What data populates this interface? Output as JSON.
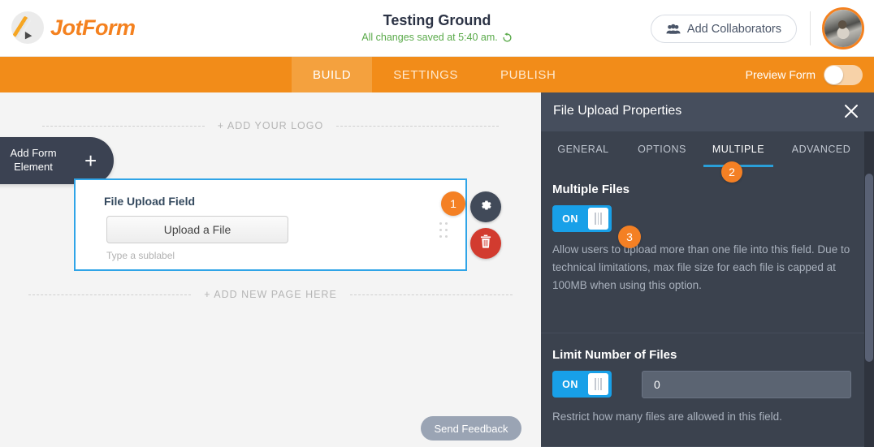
{
  "header": {
    "brand": "JotForm",
    "brand_icon": "pencil-logo-icon",
    "form_title": "Testing Ground",
    "save_status": "All changes saved at 5:40 am.",
    "undo_icon": "undo-refresh-icon",
    "collaborators_label": "Add Collaborators",
    "collaborators_icon": "people-icon",
    "avatar_icon": "user-avatar",
    "accent_color": "#f4811f",
    "status_color": "#5aaa4a"
  },
  "navbar": {
    "tabs": [
      {
        "label": "BUILD",
        "active": true
      },
      {
        "label": "SETTINGS",
        "active": false
      },
      {
        "label": "PUBLISH",
        "active": false
      }
    ],
    "preview_label": "Preview Form",
    "preview_toggle_state": "off",
    "background_color": "#f28c19",
    "active_tab_color": "#f4a13e"
  },
  "canvas": {
    "add_element": {
      "line1": "Add Form",
      "line2": "Element",
      "plus": "+",
      "icon": "plus-icon"
    },
    "add_logo_label": "+ ADD YOUR LOGO",
    "add_page_label": "+ ADD NEW PAGE HERE",
    "field": {
      "label": "File Upload Field",
      "upload_button": "Upload a File",
      "sublabel": "Type a sublabel",
      "selected_border_color": "#2fa4e7",
      "gear_icon": "gear-icon",
      "trash_icon": "trash-icon",
      "drag_icon": "drag-handle-icon",
      "badge": "1"
    },
    "send_feedback_label": "Send Feedback"
  },
  "panel": {
    "title": "File Upload Properties",
    "close_icon": "close-icon",
    "tabs": [
      {
        "label": "GENERAL",
        "active": false
      },
      {
        "label": "OPTIONS",
        "active": false
      },
      {
        "label": "MULTIPLE",
        "active": true
      },
      {
        "label": "ADVANCED",
        "active": false
      }
    ],
    "active_tab_badge": "2",
    "sections": [
      {
        "title": "Multiple Files",
        "toggle_label": "ON",
        "toggle_state": "on",
        "badge": "3",
        "description": "Allow users to upload more than one file into this field. Due to technical limitations, max file size for each file is capped at 100MB when using this option."
      },
      {
        "title": "Limit Number of Files",
        "toggle_label": "ON",
        "toggle_state": "on",
        "input_value": "0",
        "input_placeholder": "0",
        "description": "Restrict how many files are allowed in this field."
      }
    ],
    "background_color": "#3b424e",
    "header_color": "#464e5d",
    "toggle_on_color": "#18a0e8",
    "tab_underline_color": "#2a9fd8"
  }
}
